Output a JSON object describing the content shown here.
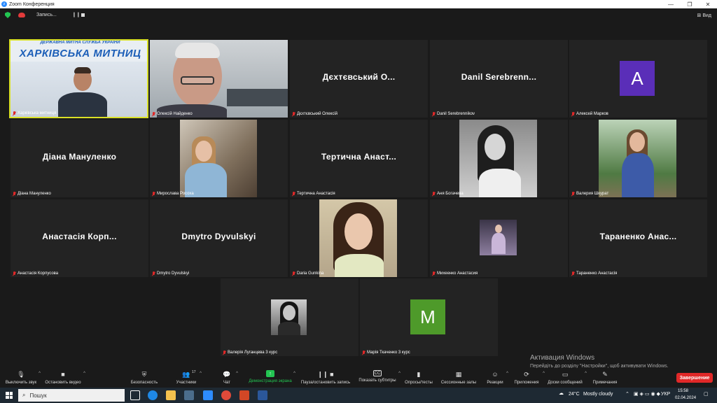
{
  "window": {
    "title": "Zoom Конференция",
    "min": "—",
    "max": "❐",
    "close": "✕"
  },
  "topbar": {
    "rec_label": "Запись...",
    "pause": "❙❙",
    "view_label": "Вид"
  },
  "tiles": [
    {
      "name_label": "Харківська митниця",
      "display": "",
      "kind": "video-customs"
    },
    {
      "name_label": "Олексій Найденко",
      "display": "",
      "kind": "video-man"
    },
    {
      "name_label": "Дєхтєвський Олексій",
      "display": "Дєхтєвський О...",
      "kind": "name"
    },
    {
      "name_label": "Danil Serebrennikov",
      "display": "Danil  Serebrenn...",
      "kind": "name"
    },
    {
      "name_label": "Алексей Марков",
      "display": "A",
      "kind": "avatar",
      "color": "#5a2eb8"
    },
    {
      "name_label": "Діана Мануленко",
      "display": "Діана Мануленко",
      "kind": "name"
    },
    {
      "name_label": "Мирослава Росоха",
      "display": "",
      "kind": "video"
    },
    {
      "name_label": "Тертична Анастасія",
      "display": "Тертична  Анаст...",
      "kind": "name"
    },
    {
      "name_label": "Аня Богачева",
      "display": "",
      "kind": "video"
    },
    {
      "name_label": "Валерия Шкурат",
      "display": "",
      "kind": "video"
    },
    {
      "name_label": "Анастасія Корпусова",
      "display": "Анастасія  Корп...",
      "kind": "name"
    },
    {
      "name_label": "Dmytro Dyvulskyi",
      "display": "Dmytro  Dyvulskyi",
      "kind": "name"
    },
    {
      "name_label": "Daria Gunkina",
      "display": "",
      "kind": "video"
    },
    {
      "name_label": "Михеенко Анастасия",
      "display": "",
      "kind": "video"
    },
    {
      "name_label": "Тараненко Анастасія",
      "display": "Тараненко  Анас...",
      "kind": "name"
    },
    {
      "name_label": "Валерія Луганцева 3 курс",
      "display": "",
      "kind": "video"
    },
    {
      "name_label": "Марія Ткаченко 3 курс",
      "display": "M",
      "kind": "avatar",
      "color": "#4e9a2a"
    }
  ],
  "customs_banner": {
    "line1": "ДЕРЖАВНА МИТНА СЛУЖБА УКРАЇНИ",
    "line2": "ХАРКІВСЬКА МИТНИЦ"
  },
  "watermark": {
    "title": "Активация Windows",
    "subtitle": "Перейдіть до розділу \"Настройки\", щоб активувати Windows."
  },
  "toolbar": {
    "mute": "Выключить звук",
    "stop_video": "Остановить видео",
    "security": "Безопасность",
    "participants": "Участники",
    "participants_count": "17",
    "chat": "Чат",
    "share": "Демонстрация экрана",
    "pause_rec": "Пауза/остановить запись",
    "subtitles": "Показать субтитры",
    "polls": "Опросы/тесты",
    "breakout": "Сессионные залы",
    "reactions": "Реакции",
    "apps": "Приложения",
    "whiteboards": "Доски сообщений",
    "notes": "Примечания",
    "end": "Завершение",
    "cc": "CC"
  },
  "taskbar": {
    "search_placeholder": "Пошук",
    "weather_temp": "24°C",
    "weather_text": "Mostly cloudy",
    "lang": "УКР",
    "time": "15:58",
    "date": "02.04.2024"
  },
  "colors": {
    "active_border": "#d9e026",
    "end_button": "#e02828",
    "share_green": "#23c552"
  }
}
